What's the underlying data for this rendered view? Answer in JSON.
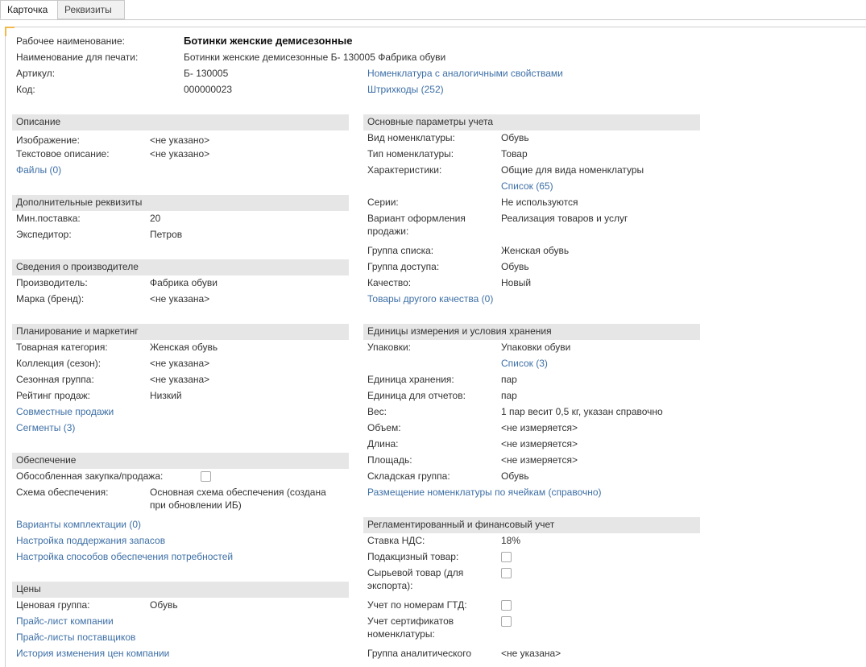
{
  "tabs": {
    "card": "Карточка",
    "requisites": "Реквизиты"
  },
  "header": {
    "work_name_label": "Рабочее наименование:",
    "work_name_value": "Ботинки женские демисезонные",
    "print_name_label": "Наименование для печати:",
    "print_name_value": "Ботинки женские демисезонные Б- 130005 Фабрика обуви",
    "article_label": "Артикул:",
    "article_value": "Б- 130005",
    "code_label": "Код:",
    "code_value": "000000023",
    "similar_link": "Номенклатура с аналогичными свойствами",
    "barcodes_link": "Штрихкоды (252)"
  },
  "description": {
    "title": "Описание",
    "image_label": "Изображение:",
    "image_value": "<не указано>",
    "text_label": "Текстовое описание:",
    "text_value": "<не указано>",
    "files_link": "Файлы (0)"
  },
  "additional": {
    "title": "Дополнительные реквизиты",
    "min_supply_label": "Мин.поставка:",
    "min_supply_value": "20",
    "forwarder_label": "Экспедитор:",
    "forwarder_value": "Петров"
  },
  "manufacturer": {
    "title": "Сведения о производителе",
    "producer_label": "Производитель:",
    "producer_value": "Фабрика обуви",
    "brand_label": "Марка (бренд):",
    "brand_value": "<не указана>"
  },
  "planning": {
    "title": "Планирование и маркетинг",
    "category_label": "Товарная категория:",
    "category_value": "Женская обувь",
    "collection_label": "Коллекция (сезон):",
    "collection_value": "<не указана>",
    "season_label": "Сезонная группа:",
    "season_value": "<не указана>",
    "rating_label": "Рейтинг продаж:",
    "rating_value": "Низкий",
    "joint_sales_link": "Совместные продажи",
    "segments_link": "Сегменты (3)"
  },
  "supply": {
    "title": "Обеспечение",
    "separate_label": "Обособленная закупка/продажа:",
    "separate_checked": false,
    "scheme_label": "Схема обеспечения:",
    "scheme_value_1": "Основная схема обеспечения (создана",
    "scheme_value_2": "при обновлении ИБ)",
    "kits_link": "Варианты комплектации (0)",
    "stock_link": "Настройка поддержания запасов",
    "methods_link": "Настройка способов обеспечения потребностей"
  },
  "prices": {
    "title": "Цены",
    "price_group_label": "Ценовая группа:",
    "price_group_value": "Обувь",
    "company_list_link": "Прайс-лист компании",
    "suppliers_link": "Прайс-листы поставщиков",
    "history_link": "История изменения цен компании"
  },
  "accounting": {
    "title": "Основные параметры учета",
    "kind_label": "Вид номенклатуры:",
    "kind_value": "Обувь",
    "type_label": "Тип номенклатуры:",
    "type_value": "Товар",
    "chars_label": "Характеристики:",
    "chars_value": "Общие для вида номенклатуры",
    "chars_list_link": "Список (65)",
    "series_label": "Серии:",
    "series_value": "Не используются",
    "sale_variant_label_1": "Вариант оформления",
    "sale_variant_label_2": "продажи:",
    "sale_variant_value": "Реализация товаров и услуг",
    "list_group_label": "Группа списка:",
    "list_group_value": "Женская обувь",
    "access_group_label": "Группа доступа:",
    "access_group_value": "Обувь",
    "quality_label": "Качество:",
    "quality_value": "Новый",
    "other_quality_link": "Товары другого качества (0)"
  },
  "units": {
    "title": "Единицы измерения и условия хранения",
    "packages_label": "Упаковки:",
    "packages_value": "Упаковки обуви",
    "packages_list_link": "Список (3)",
    "storage_unit_label": "Единица хранения:",
    "storage_unit_value": "пар",
    "report_unit_label": "Единица для отчетов:",
    "report_unit_value": "пар",
    "weight_label": "Вес:",
    "weight_value": "1 пар весит 0,5 кг, указан справочно",
    "volume_label": "Объем:",
    "volume_value": "<не измеряется>",
    "length_label": "Длина:",
    "length_value": "<не измеряется>",
    "area_label": "Площадь:",
    "area_value": "<не измеряется>",
    "warehouse_group_label": "Складская группа:",
    "warehouse_group_value": "Обувь",
    "cells_link": "Размещение номенклатуры по ячейкам (справочно)"
  },
  "regulated": {
    "title": "Регламентированный и финансовый учет",
    "vat_label": "Ставка НДС:",
    "vat_value": "18%",
    "excise_label": "Подакцизный товар:",
    "excise_checked": false,
    "raw_label_1": "Сырьевой товар (для",
    "raw_label_2": "экспорта):",
    "raw_checked": false,
    "gtd_label": "Учет по номерам ГТД:",
    "gtd_checked": false,
    "cert_label_1": "Учет сертификатов",
    "cert_label_2": "номенклатуры:",
    "cert_checked": false,
    "analytic_label": "Группа аналитического",
    "analytic_value": "<не указана>"
  }
}
